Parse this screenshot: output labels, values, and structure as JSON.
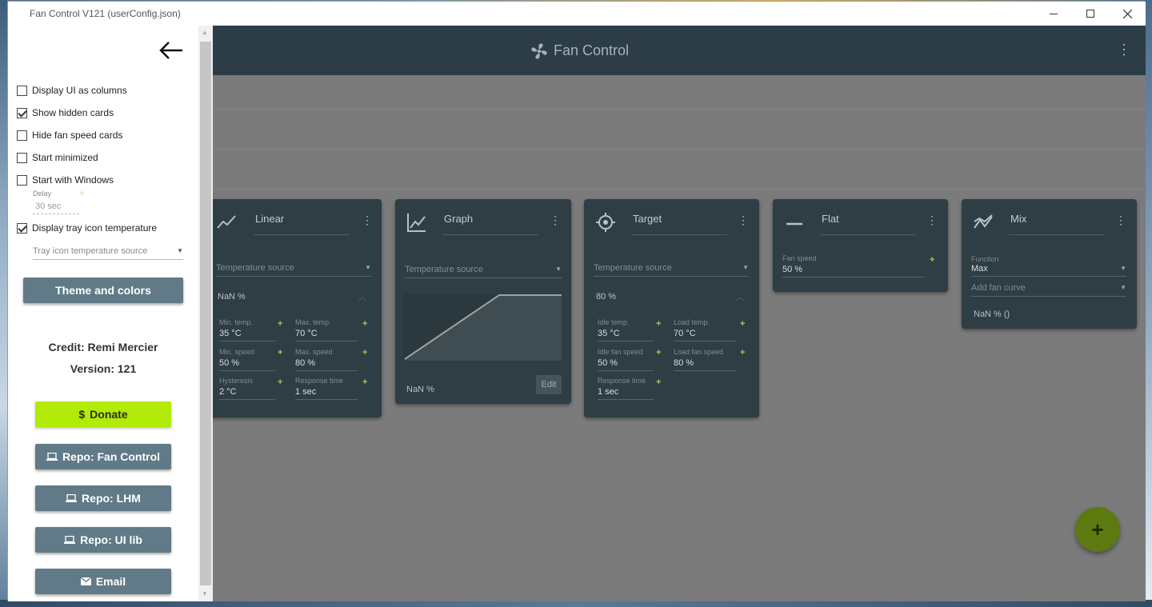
{
  "window": {
    "title": "Fan Control V121 (userConfig.json)"
  },
  "appbar": {
    "title": "Fan Control"
  },
  "sidepanel": {
    "checkboxes": [
      {
        "label": "Display UI as columns",
        "checked": false
      },
      {
        "label": "Show hidden cards",
        "checked": true
      },
      {
        "label": "Hide fan speed cards",
        "checked": false
      },
      {
        "label": "Start minimized",
        "checked": false
      },
      {
        "label": "Start with Windows",
        "checked": false
      },
      {
        "label": "Display tray icon temperature",
        "checked": true
      }
    ],
    "delay": {
      "label": "Delay",
      "value": "30 sec"
    },
    "tray_source_placeholder": "Tray icon temperature source",
    "theme_button": "Theme and colors",
    "credit": "Credit: Remi Mercier",
    "version": "Version: 121",
    "donate_button": "Donate",
    "repo_fan_control": "Repo: Fan Control",
    "repo_lhm": "Repo: LHM",
    "repo_ui_lib": "Repo: UI lib",
    "email_button": "Email"
  },
  "cards": {
    "linear": {
      "title": "Linear",
      "temp_source": "Temperature source",
      "output": "NaN %",
      "min_temp_label": "Min. temp.",
      "min_temp": "35 °C",
      "max_temp_label": "Max. temp.",
      "max_temp": "70 °C",
      "min_speed_label": "Min. speed",
      "min_speed": "50 %",
      "max_speed_label": "Max. speed",
      "max_speed": "80 %",
      "hysteresis_label": "Hysteresis",
      "hysteresis": "2 °C",
      "response_label": "Response time",
      "response": "1 sec"
    },
    "graph": {
      "title": "Graph",
      "temp_source": "Temperature source",
      "output": "NaN %",
      "edit_button": "Edit"
    },
    "target": {
      "title": "Target",
      "temp_source": "Temperature source",
      "output": "80 %",
      "idle_temp_label": "Idle temp.",
      "idle_temp": "35 °C",
      "load_temp_label": "Load temp.",
      "load_temp": "70 °C",
      "idle_speed_label": "Idle fan speed",
      "idle_speed": "50 %",
      "load_speed_label": "Load fan speed",
      "load_speed": "80 %",
      "response_label": "Response time",
      "response": "1 sec"
    },
    "flat": {
      "title": "Flat",
      "fan_speed_label": "Fan speed",
      "fan_speed": "50 %"
    },
    "mix": {
      "title": "Mix",
      "function_label": "Function",
      "function": "Max",
      "add_curve": "Add fan curve",
      "output": "NaN % ()"
    }
  },
  "fab_label": "+",
  "colors": {
    "accent": "#b2ea0a",
    "card_bg": "#2f3e45",
    "appbar": "#2c3d47",
    "button": "#617a87"
  }
}
